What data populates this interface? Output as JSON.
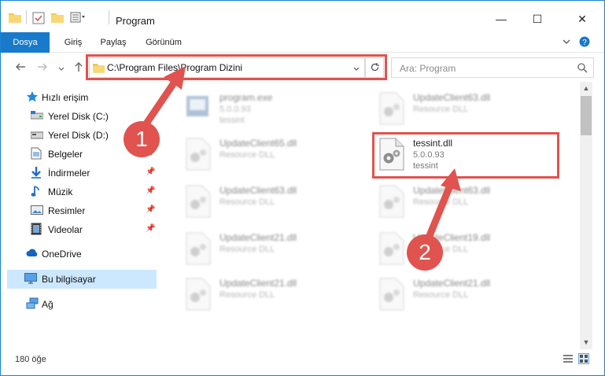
{
  "window": {
    "title": "Program",
    "controls": {
      "minimize": "—",
      "maximize": "☐",
      "close": "✕"
    }
  },
  "ribbon": {
    "tabs": [
      "Dosya",
      "Giriş",
      "Paylaş",
      "Görünüm"
    ],
    "collapse_icon": "chevron-down-icon",
    "help_icon": "help-icon"
  },
  "address_bar": {
    "path": "C:\\Program Files\\Program Dizini",
    "search_placeholder": "Ara: Program"
  },
  "sidebar": {
    "quick_access": "Hızlı erişim",
    "items": [
      {
        "label": "Yerel Disk (C:)",
        "icon": "drive-icon",
        "pinned": false
      },
      {
        "label": "Yerel Disk (D:)",
        "icon": "drive-icon",
        "pinned": false
      },
      {
        "label": "Belgeler",
        "icon": "documents-icon",
        "pinned": true
      },
      {
        "label": "İndirmeler",
        "icon": "downloads-icon",
        "pinned": true
      },
      {
        "label": "Müzik",
        "icon": "music-icon",
        "pinned": true
      },
      {
        "label": "Resimler",
        "icon": "pictures-icon",
        "pinned": true
      },
      {
        "label": "Videolar",
        "icon": "videos-icon",
        "pinned": true
      }
    ],
    "onedrive": "OneDrive",
    "this_pc": "Bu bilgisayar",
    "network": "Ağ"
  },
  "files": [
    {
      "name": "program.exe",
      "line1": "5.0.0.93",
      "line2": "tessint",
      "blurred": true
    },
    {
      "name": "UpdateClient63.dll",
      "line1": "Resource DLL",
      "line2": "",
      "blurred": true
    },
    {
      "name": "UpdateClient65.dll",
      "line1": "Resource DLL",
      "line2": "",
      "blurred": true
    },
    {
      "name": "tessint.dll",
      "line1": "5.0.0.93",
      "line2": "tessint",
      "blurred": false
    },
    {
      "name": "UpdateClient63.dll",
      "line1": "Resource DLL",
      "line2": "",
      "blurred": true
    },
    {
      "name": "UpdateClient63.dll",
      "line1": "Resource DLL",
      "line2": "",
      "blurred": true
    },
    {
      "name": "UpdateClient21.dll",
      "line1": "Resource DLL",
      "line2": "",
      "blurred": true
    },
    {
      "name": "UpdateClient19.dll",
      "line1": "Resource DLL",
      "line2": "",
      "blurred": true
    },
    {
      "name": "UpdateClient21.dll",
      "line1": "Resource DLL",
      "line2": "",
      "blurred": true
    },
    {
      "name": "UpdateClient21.dll",
      "line1": "Resource DLL",
      "line2": "",
      "blurred": true
    }
  ],
  "status": {
    "item_count": "180 öğe"
  },
  "annotations": {
    "step1": "1",
    "step2": "2",
    "color": "#e0534f"
  },
  "colors": {
    "accent": "#1979ca",
    "selection": "#cce8ff"
  }
}
